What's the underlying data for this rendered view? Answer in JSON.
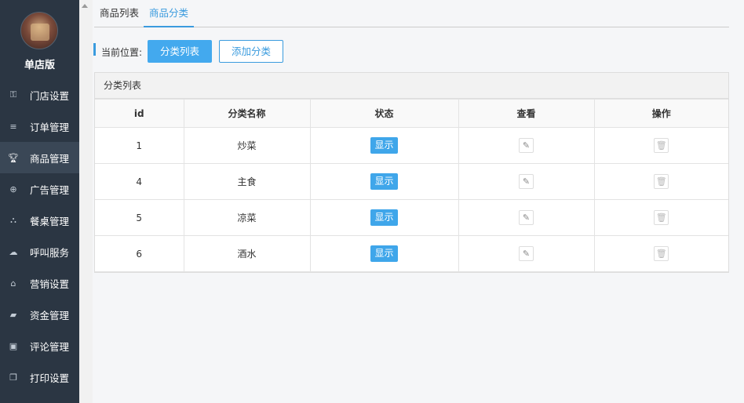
{
  "sidebar": {
    "brand_name": "单店版",
    "items": [
      {
        "label": "门店设置",
        "icon": "key-icon",
        "glyph": "⚿"
      },
      {
        "label": "订单管理",
        "icon": "list-icon",
        "glyph": "≡"
      },
      {
        "label": "商品管理",
        "icon": "trophy-icon",
        "glyph": "🏆︎",
        "active": true
      },
      {
        "label": "广告管理",
        "icon": "lifebuoy-icon",
        "glyph": "⊕"
      },
      {
        "label": "餐桌管理",
        "icon": "binoculars-icon",
        "glyph": "⛬"
      },
      {
        "label": "呼叫服务",
        "icon": "cloud-icon",
        "glyph": "☁"
      },
      {
        "label": "营销设置",
        "icon": "gift-icon",
        "glyph": "⌂"
      },
      {
        "label": "资金管理",
        "icon": "book-icon",
        "glyph": "▰"
      },
      {
        "label": "评论管理",
        "icon": "money-icon",
        "glyph": "▣"
      },
      {
        "label": "打印设置",
        "icon": "copy-icon",
        "glyph": "❐"
      }
    ]
  },
  "tabs": [
    {
      "label": "商品列表"
    },
    {
      "label": "商品分类",
      "active": true
    }
  ],
  "location": {
    "label": "当前位置:",
    "primary_button": "分类列表",
    "secondary_button": "添加分类"
  },
  "panel": {
    "title": "分类列表",
    "columns": [
      "id",
      "分类名称",
      "状态",
      "查看",
      "操作"
    ],
    "rows": [
      {
        "id": "1",
        "name": "炒菜",
        "status": "显示"
      },
      {
        "id": "4",
        "name": "主食",
        "status": "显示"
      },
      {
        "id": "5",
        "name": "凉菜",
        "status": "显示"
      },
      {
        "id": "6",
        "name": "酒水",
        "status": "显示"
      }
    ]
  },
  "colors": {
    "sidebar_bg": "#2b3643",
    "accent": "#3a9bde",
    "badge": "#3fa6ea"
  }
}
